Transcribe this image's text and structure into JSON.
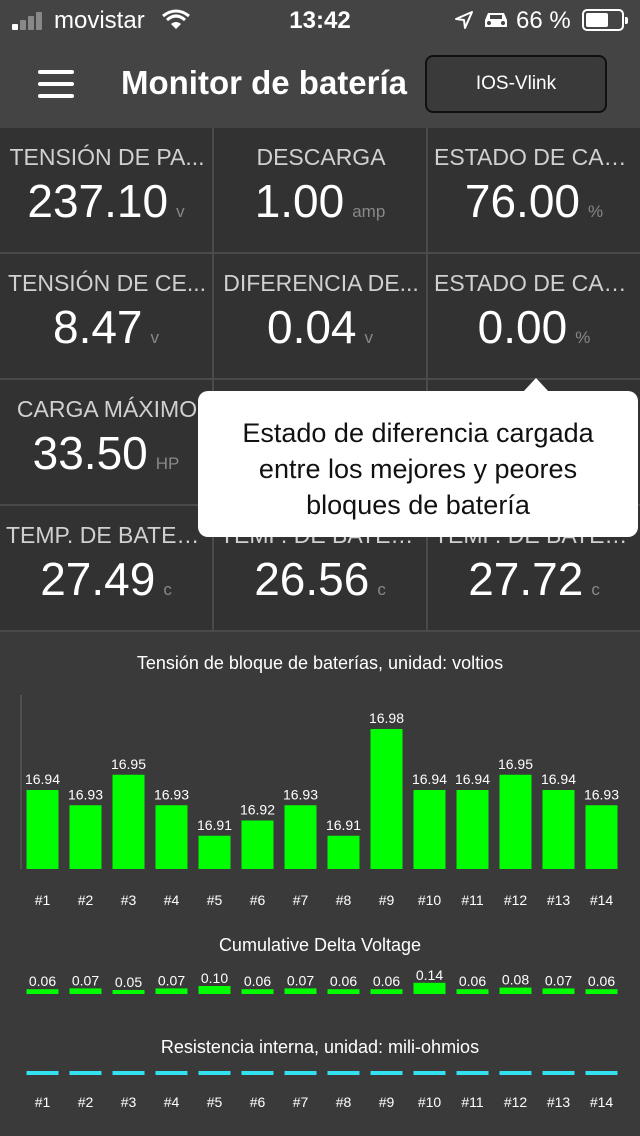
{
  "status": {
    "carrier": "movistar",
    "time": "13:42",
    "battery_pct": "66 %",
    "battery_level": 0.66
  },
  "header": {
    "title": "Monitor de batería",
    "device_button": "IOS-Vlink"
  },
  "metrics": [
    {
      "label": "TENSIÓN DE PA...",
      "value": "237.10",
      "unit": "v"
    },
    {
      "label": "DESCARGA",
      "value": "1.00",
      "unit": "amp"
    },
    {
      "label": "ESTADO DE CAR...",
      "value": "76.00",
      "unit": "%"
    },
    {
      "label": "TENSIÓN DE CE...",
      "value": "8.47",
      "unit": "v"
    },
    {
      "label": "DIFERENCIA DE...",
      "value": "0.04",
      "unit": "v"
    },
    {
      "label": "ESTADO DE CAR...",
      "value": "0.00",
      "unit": "%"
    },
    {
      "label": "CARGA MÁXIMO",
      "value": "33.50",
      "unit": "HP"
    },
    {
      "label": "",
      "value": "",
      "unit": ""
    },
    {
      "label": "",
      "value": "",
      "unit": ""
    },
    {
      "label": "TEMP. DE BATER...",
      "value": "27.49",
      "unit": "c"
    },
    {
      "label": "TEMP. DE BATER...",
      "value": "26.56",
      "unit": "c"
    },
    {
      "label": "TEMP. DE BATER...",
      "value": "27.72",
      "unit": "c"
    }
  ],
  "tooltip": {
    "line1": "Estado de diferencia cargada",
    "line2": "entre los mejores y peores",
    "line3": "bloques de batería"
  },
  "colors": {
    "bar_green": "#00ff00",
    "resistance_cyan": "#33e0f0",
    "background": "#3a3a3a"
  },
  "chart_data": [
    {
      "type": "bar",
      "title": "Tensión de bloque de baterías, unidad: voltios",
      "categories": [
        "#1",
        "#2",
        "#3",
        "#4",
        "#5",
        "#6",
        "#7",
        "#8",
        "#9",
        "#10",
        "#11",
        "#12",
        "#13",
        "#14"
      ],
      "values": [
        16.94,
        16.93,
        16.95,
        16.93,
        16.91,
        16.92,
        16.93,
        16.91,
        16.98,
        16.94,
        16.94,
        16.95,
        16.94,
        16.93
      ],
      "labels": [
        "16.94",
        "16.93",
        "16.95",
        "16.93",
        "16.91",
        "16.92",
        "16.93",
        "16.91",
        "16.98",
        "16.94",
        "16.94",
        "16.95",
        "16.94",
        "16.93"
      ],
      "ylim": [
        16.9,
        16.98
      ]
    },
    {
      "type": "bar",
      "title": "Cumulative Delta Voltage",
      "categories": [
        "#1",
        "#2",
        "#3",
        "#4",
        "#5",
        "#6",
        "#7",
        "#8",
        "#9",
        "#10",
        "#11",
        "#12",
        "#13",
        "#14"
      ],
      "values": [
        0.06,
        0.07,
        0.05,
        0.07,
        0.1,
        0.06,
        0.07,
        0.06,
        0.06,
        0.14,
        0.06,
        0.08,
        0.07,
        0.06
      ],
      "labels": [
        "0.06",
        "0.07",
        "0.05",
        "0.07",
        "0.10",
        "0.06",
        "0.07",
        "0.06",
        "0.06",
        "0.14",
        "0.06",
        "0.08",
        "0.07",
        "0.06"
      ]
    },
    {
      "type": "bar",
      "title": "Resistencia interna, unidad: mili-ohmios",
      "categories": [
        "#1",
        "#2",
        "#3",
        "#4",
        "#5",
        "#6",
        "#7",
        "#8",
        "#9",
        "#10",
        "#11",
        "#12",
        "#13",
        "#14"
      ]
    }
  ]
}
